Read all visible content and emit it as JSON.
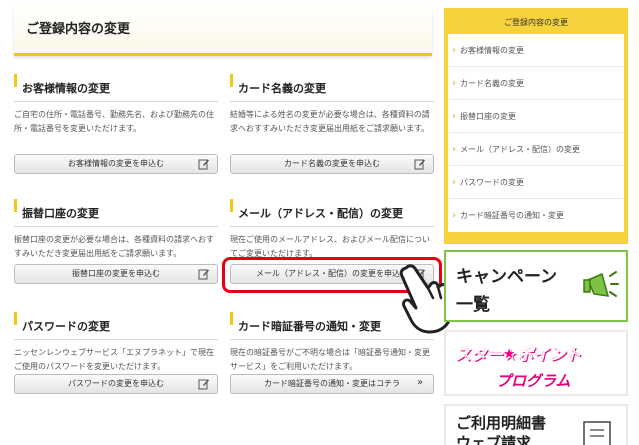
{
  "page_title": "ご登録内容の変更",
  "cards": [
    {
      "title": "お客様情報の変更",
      "desc": "ご自宅の住所・電話番号、勤務先名、および勤務先の住所・電話番号を変更いただけます。",
      "button": "お客様情報の変更を申込む"
    },
    {
      "title": "カード名義の変更",
      "desc": "結婚等による姓名の変更が必要な場合は、各種資料の請求へおすすみいただき変更届出用紙をご請求願います。",
      "button": "カード名義の変更を申込む"
    },
    {
      "title": "振替口座の変更",
      "desc": "振替口座の変更が必要な場合は、各種資料の請求へおすすみいただき変更届出用紙をご請求願います。",
      "button": "振替口座の変更を申込む"
    },
    {
      "title": "メール（アドレス・配信）の変更",
      "desc": "現在ご使用のメールアドレス、およびメール配信についてご変更いただけます。",
      "button": "メール（アドレス・配信）の変更を申込む"
    },
    {
      "title": "パスワードの変更",
      "desc": "ニッセンレンウェブサービス「エヌプラネット」で現在ご使用のパスワードを変更いただけます。",
      "button": "パスワードの変更を申込む"
    },
    {
      "title": "カード暗証番号の通知・変更",
      "desc": "現在の暗証番号がご不明な場合は「暗証番号通知・変更サービス」をご利用いただけます。",
      "button": "カード暗証番号の通知・変更はコチラ"
    }
  ],
  "sidebar": {
    "title": "ご登録内容の変更",
    "items": [
      {
        "label": "お客様情報の変更"
      },
      {
        "label": "カード名義の変更"
      },
      {
        "label": "振替口座の変更"
      },
      {
        "label": "メール（アドレス・配信）の変更"
      },
      {
        "label": "パスワードの変更"
      },
      {
        "label": "カード暗証番号の通知・変更"
      }
    ]
  },
  "banners": {
    "campaign_line1": "キャンペーン",
    "campaign_line2": "一覧",
    "star_line1": "スター★ポイント",
    "star_line2": "プログラム",
    "meisai_line1": "ご利用明細書",
    "meisai_line2": "ウェブ請求"
  },
  "colors": {
    "accent": "#f2c613",
    "sidebar_bg": "#f6d23c",
    "highlight": "#e60012",
    "campaign_border": "#7cc243",
    "star_pink": "#e6007e"
  },
  "icons": {
    "edit": "pencil-edit-icon",
    "arrow": "double-chevron-right-icon",
    "pointer": "hand-pointer-icon",
    "megaphone": "megaphone-icon"
  }
}
